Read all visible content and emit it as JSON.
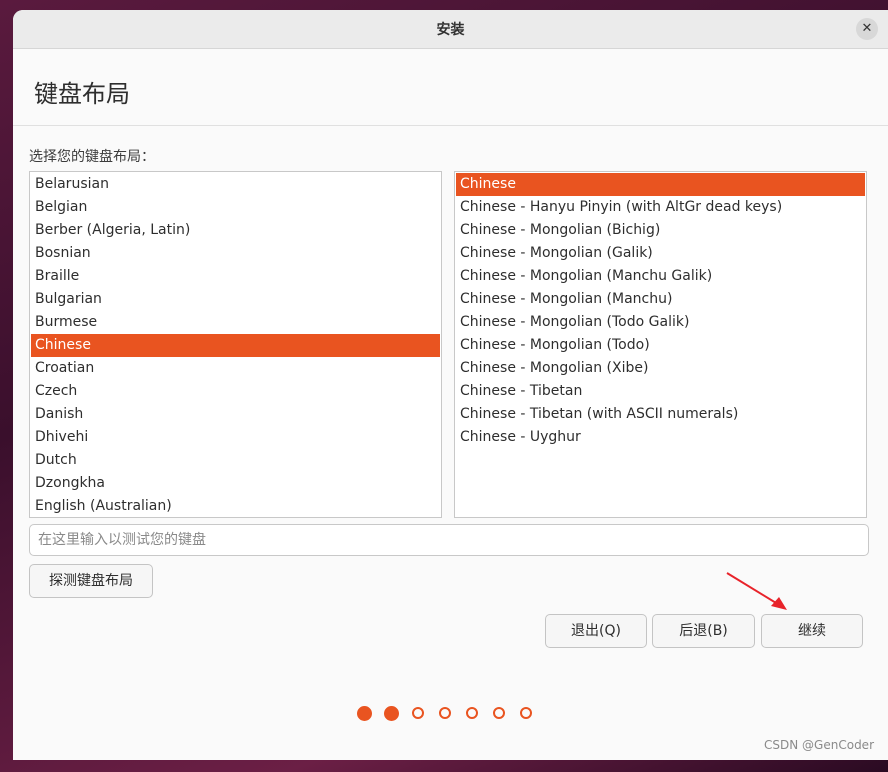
{
  "window": {
    "title": "安装",
    "close_glyph": "✕"
  },
  "header": {
    "heading": "键盘布局"
  },
  "prompt": "选择您的键盘布局：",
  "layouts": [
    {
      "label": "Belarusian",
      "selected": false
    },
    {
      "label": "Belgian",
      "selected": false
    },
    {
      "label": "Berber (Algeria, Latin)",
      "selected": false
    },
    {
      "label": "Bosnian",
      "selected": false
    },
    {
      "label": "Braille",
      "selected": false
    },
    {
      "label": "Bulgarian",
      "selected": false
    },
    {
      "label": "Burmese",
      "selected": false
    },
    {
      "label": "Chinese",
      "selected": true
    },
    {
      "label": "Croatian",
      "selected": false
    },
    {
      "label": "Czech",
      "selected": false
    },
    {
      "label": "Danish",
      "selected": false
    },
    {
      "label": "Dhivehi",
      "selected": false
    },
    {
      "label": "Dutch",
      "selected": false
    },
    {
      "label": "Dzongkha",
      "selected": false
    },
    {
      "label": "English (Australian)",
      "selected": false
    }
  ],
  "variants": [
    {
      "label": "Chinese",
      "selected": true
    },
    {
      "label": "Chinese - Hanyu Pinyin (with AltGr dead keys)",
      "selected": false
    },
    {
      "label": "Chinese - Mongolian (Bichig)",
      "selected": false
    },
    {
      "label": "Chinese - Mongolian (Galik)",
      "selected": false
    },
    {
      "label": "Chinese - Mongolian (Manchu Galik)",
      "selected": false
    },
    {
      "label": "Chinese - Mongolian (Manchu)",
      "selected": false
    },
    {
      "label": "Chinese - Mongolian (Todo Galik)",
      "selected": false
    },
    {
      "label": "Chinese - Mongolian (Todo)",
      "selected": false
    },
    {
      "label": "Chinese - Mongolian (Xibe)",
      "selected": false
    },
    {
      "label": "Chinese - Tibetan",
      "selected": false
    },
    {
      "label": "Chinese - Tibetan (with ASCII numerals)",
      "selected": false
    },
    {
      "label": "Chinese - Uyghur",
      "selected": false
    }
  ],
  "test_input": {
    "placeholder": "在这里输入以测试您的键盘",
    "value": ""
  },
  "buttons": {
    "detect": "探测键盘布局",
    "quit": "退出(Q)",
    "back": "后退(B)",
    "continue": "继续"
  },
  "progress": {
    "total_steps": 7,
    "completed_steps": 2
  },
  "watermark": "CSDN @GenCoder",
  "colors": {
    "accent": "#e95420",
    "annotation_arrow": "#e8232a"
  }
}
